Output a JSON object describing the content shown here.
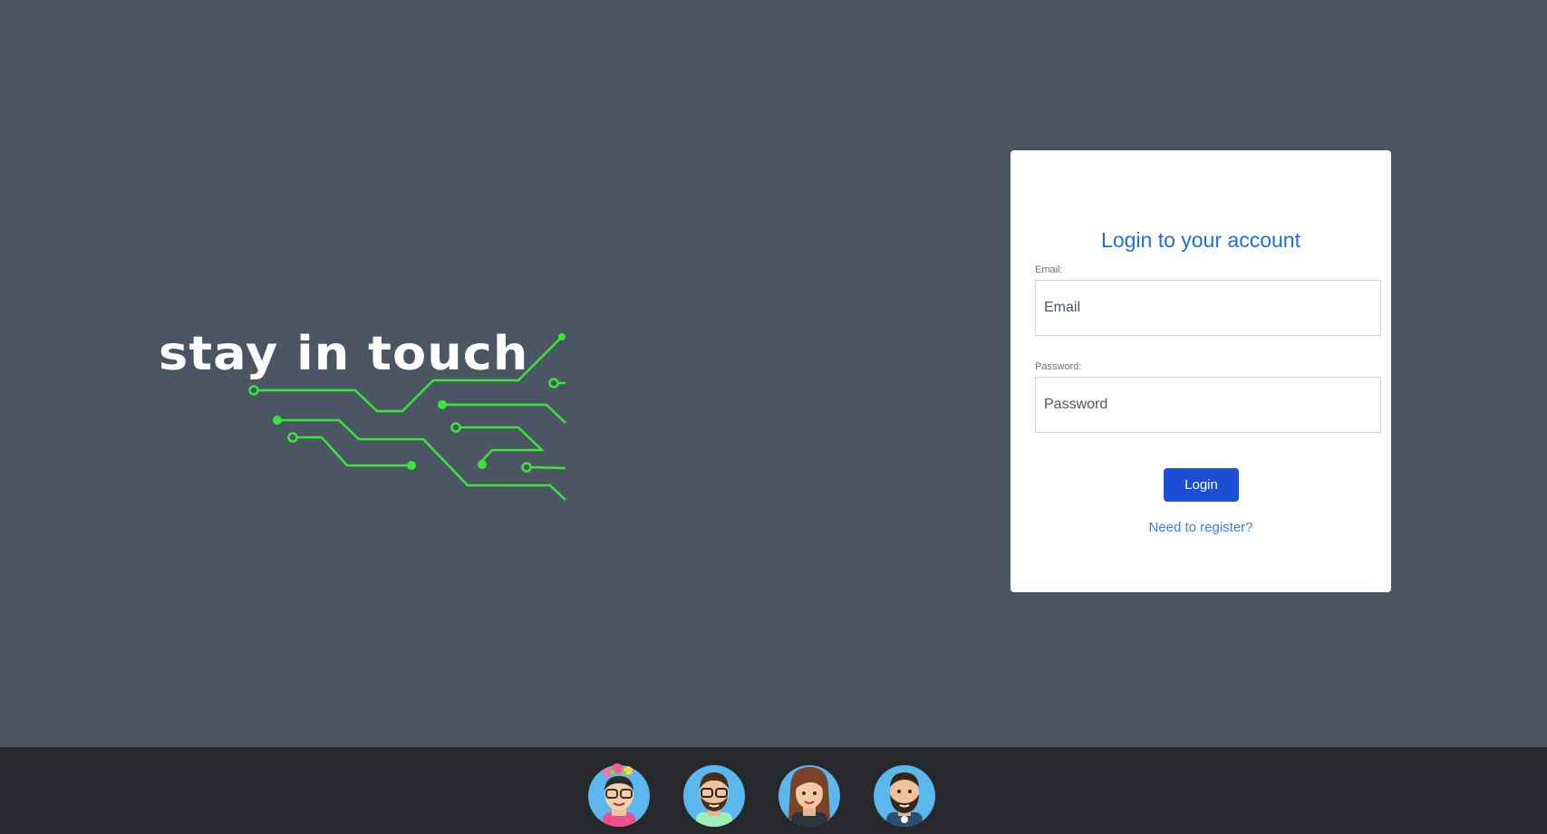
{
  "brand": {
    "tagline": "stay in touch",
    "accent_color": "#39e639"
  },
  "login_card": {
    "title": "Login to your account",
    "email_label": "Email:",
    "email_placeholder": "Email",
    "email_value": "",
    "password_label": "Password:",
    "password_placeholder": "Password",
    "password_value": "",
    "login_button": "Login",
    "register_link": "Need to register?"
  },
  "footer": {
    "avatars": [
      {
        "name": "avatar-woman-flower-crown",
        "icon": "avatar-icon"
      },
      {
        "name": "avatar-man-glasses",
        "icon": "avatar-icon"
      },
      {
        "name": "avatar-woman-brown-hair",
        "icon": "avatar-icon"
      },
      {
        "name": "avatar-man-beard",
        "icon": "avatar-icon"
      }
    ]
  }
}
